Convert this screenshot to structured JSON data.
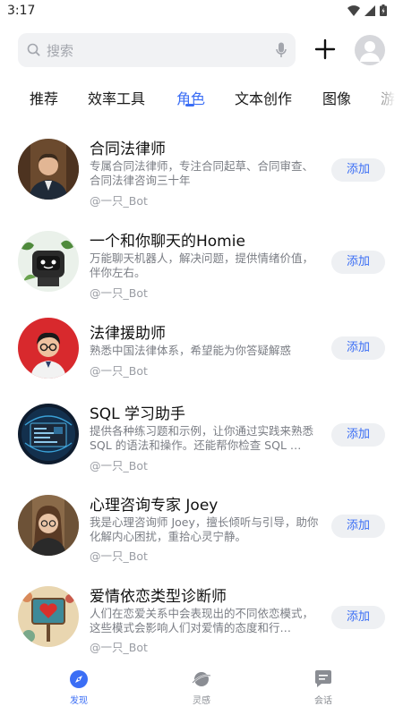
{
  "status_bar": {
    "time": "3:17"
  },
  "search": {
    "placeholder": "搜索"
  },
  "tabs": [
    {
      "label": "推荐"
    },
    {
      "label": "效率工具"
    },
    {
      "label": "角色",
      "active": true
    },
    {
      "label": "文本创作"
    },
    {
      "label": "图像"
    },
    {
      "label": "游"
    }
  ],
  "bots": [
    {
      "name": "合同法律师",
      "desc": "专属合同法律师，专注合同起草、合同审查、合同法律咨询三十年",
      "author": "@一只_Bot",
      "add_label": "添加"
    },
    {
      "name": "一个和你聊天的Homie",
      "desc": "万能聊天机器人，解决问题，提供情绪价值，伴你左右。",
      "author": "@一只_Bot",
      "add_label": "添加"
    },
    {
      "name": "法律援助师",
      "desc": "熟悉中国法律体系，希望能为你答疑解惑",
      "author": "@一只_Bot",
      "add_label": "添加"
    },
    {
      "name": "SQL 学习助手",
      "desc": "提供各种练习题和示例，让你通过实践来熟悉 SQL 的语法和操作。还能帮你检查 SQL …",
      "author": "@一只_Bot",
      "add_label": "添加"
    },
    {
      "name": "心理咨询专家 Joey",
      "desc": "我是心理咨询师 Joey，擅长倾听与引导，助你化解内心困扰，重拾心灵宁静。",
      "author": "@一只_Bot",
      "add_label": "添加"
    },
    {
      "name": "爱情依恋类型诊断师",
      "desc": "人们在恋爱关系中会表现出的不同依恋模式，这些模式会影响人们对爱情的态度和行…",
      "author": "@一只_Bot",
      "add_label": "添加"
    }
  ],
  "bottom_nav": [
    {
      "label": "发现",
      "icon": "compass-icon",
      "active": true
    },
    {
      "label": "灵感",
      "icon": "planet-icon"
    },
    {
      "label": "会话",
      "icon": "chat-icon"
    }
  ],
  "colors": {
    "accent": "#3b6ef5",
    "search_bg": "#f1f2f4",
    "button_bg": "#eef0f3"
  }
}
